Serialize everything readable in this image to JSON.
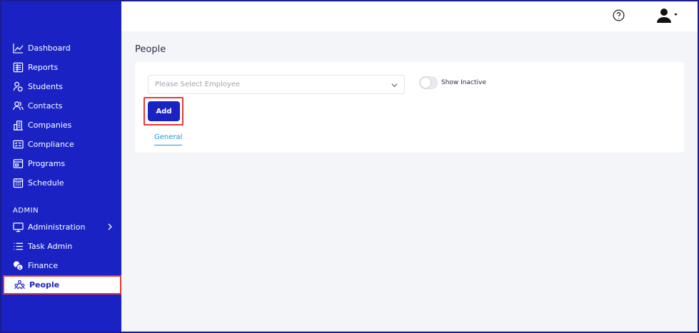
{
  "sidebar": {
    "items": [
      {
        "label": "Dashboard",
        "icon": "chart-line-icon"
      },
      {
        "label": "Reports",
        "icon": "reports-icon"
      },
      {
        "label": "Students",
        "icon": "students-icon"
      },
      {
        "label": "Contacts",
        "icon": "contacts-icon"
      },
      {
        "label": "Companies",
        "icon": "companies-icon"
      },
      {
        "label": "Compliance",
        "icon": "compliance-icon"
      },
      {
        "label": "Programs",
        "icon": "programs-icon"
      },
      {
        "label": "Schedule",
        "icon": "calendar-icon"
      }
    ],
    "admin_section": "ADMIN",
    "admin_items": [
      {
        "label": "Administration",
        "icon": "monitor-icon"
      },
      {
        "label": "Task Admin",
        "icon": "list-icon"
      },
      {
        "label": "Finance",
        "icon": "coins-icon"
      },
      {
        "label": "People",
        "icon": "people-icon",
        "active": true
      }
    ],
    "background": "#1a22c4"
  },
  "topbar": {
    "help_icon": "question-circle-icon",
    "user_icon": "user-icon"
  },
  "main": {
    "page_title": "People",
    "employee_select": {
      "placeholder": "Please Select Employee",
      "value": ""
    },
    "show_inactive": {
      "label": "Show Inactive",
      "on": false
    },
    "add_button": "Add",
    "tabs": [
      {
        "label": "General",
        "active": true
      }
    ]
  },
  "colors": {
    "accent": "#1a22c4",
    "highlight": "#e53935",
    "tab_active": "#2196d8",
    "content_bg": "#f3f5f9"
  }
}
